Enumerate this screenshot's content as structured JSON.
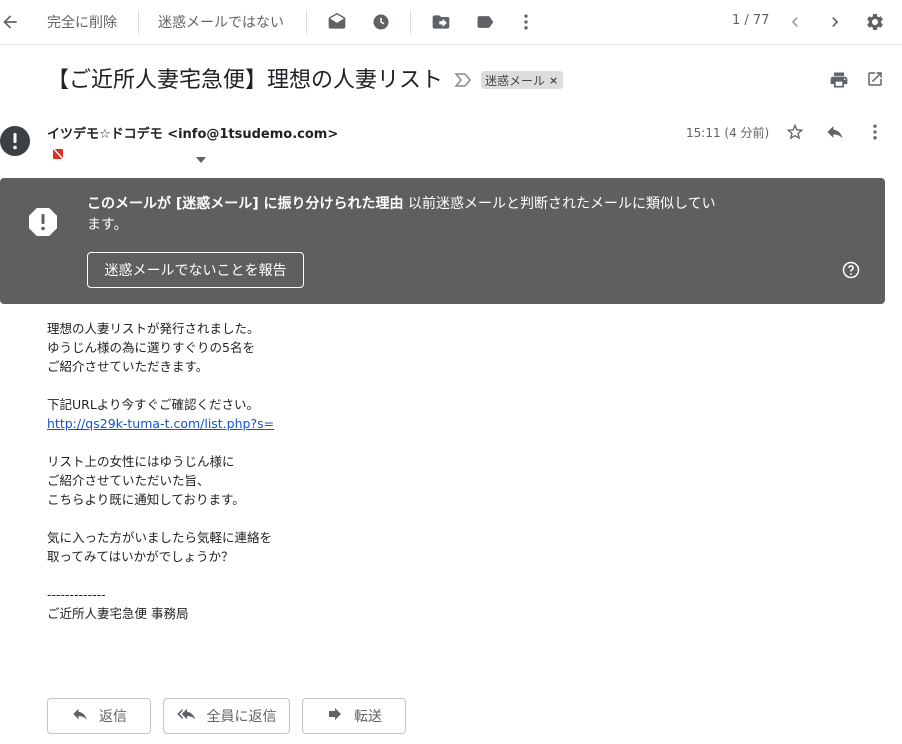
{
  "toolbar": {
    "delete_forever": "完全に削除",
    "not_spam": "迷惑メールではない",
    "count": "1 / 77"
  },
  "subject": {
    "title": "【ご近所人妻宅急便】理想の人妻リスト",
    "label": "迷惑メール",
    "label_remove": "×"
  },
  "sender": {
    "name": "イツデモ☆ドコデモ",
    "email": "<info@1tsudemo.com>",
    "time": "15:11 (4 分前)"
  },
  "spam_banner": {
    "title": "このメールが [迷惑メール] に振り分けられた理由",
    "reason": " 以前迷惑メールと判断されたメールに類似しています。",
    "button": "迷惑メールでないことを報告"
  },
  "body": {
    "lines": [
      "理想の人妻リストが発行されました。",
      "ゆうじん様の為に選りすぐりの5名を",
      "ご紹介させていただきます。",
      "",
      "下記URLより今すぐご確認ください。",
      "http://qs29k-tuma-t.com/list.php?s=",
      "",
      "リスト上の女性にはゆうじん様に",
      "ご紹介させていただいた旨、",
      "こちらより既に通知しております。",
      "",
      "気に入った方がいましたら気軽に連絡を",
      "取ってみてはいかがでしょうか？",
      "",
      "-------------",
      "ご近所人妻宅急便 事務局"
    ],
    "link": "http://qs29k-tuma-t.com/list.php?s="
  },
  "actions": {
    "reply": "返信",
    "reply_all": "全員に返信",
    "forward": "転送"
  },
  "colors": {
    "banner": "#5f5f5f",
    "link": "#1155cc",
    "icon": "#5f6368"
  }
}
